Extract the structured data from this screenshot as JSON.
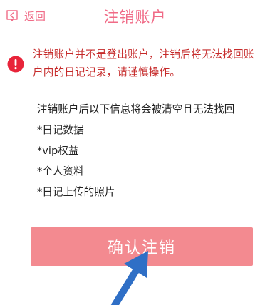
{
  "header": {
    "back_label": "返回",
    "title": "注销账户"
  },
  "warning": {
    "icon": "exclamation-circle-icon",
    "line1": "注销账户并不是登出账户，注销后将无法找回账",
    "line2": "户内的日记记录，请谨慎操作。"
  },
  "info": {
    "intro": "注销账户后以下信息将会被清空且无法找回",
    "items": [
      "*日记数据",
      "*vip权益",
      "*个人资料",
      "*日记上传的照片"
    ]
  },
  "confirm": {
    "label": "确认注销"
  },
  "colors": {
    "accent": "#f06b87",
    "warning_text": "#c62b2b",
    "warning_icon": "#e8243a",
    "button_bg": "#f38a90",
    "annotation_arrow": "#2f6fc6"
  }
}
